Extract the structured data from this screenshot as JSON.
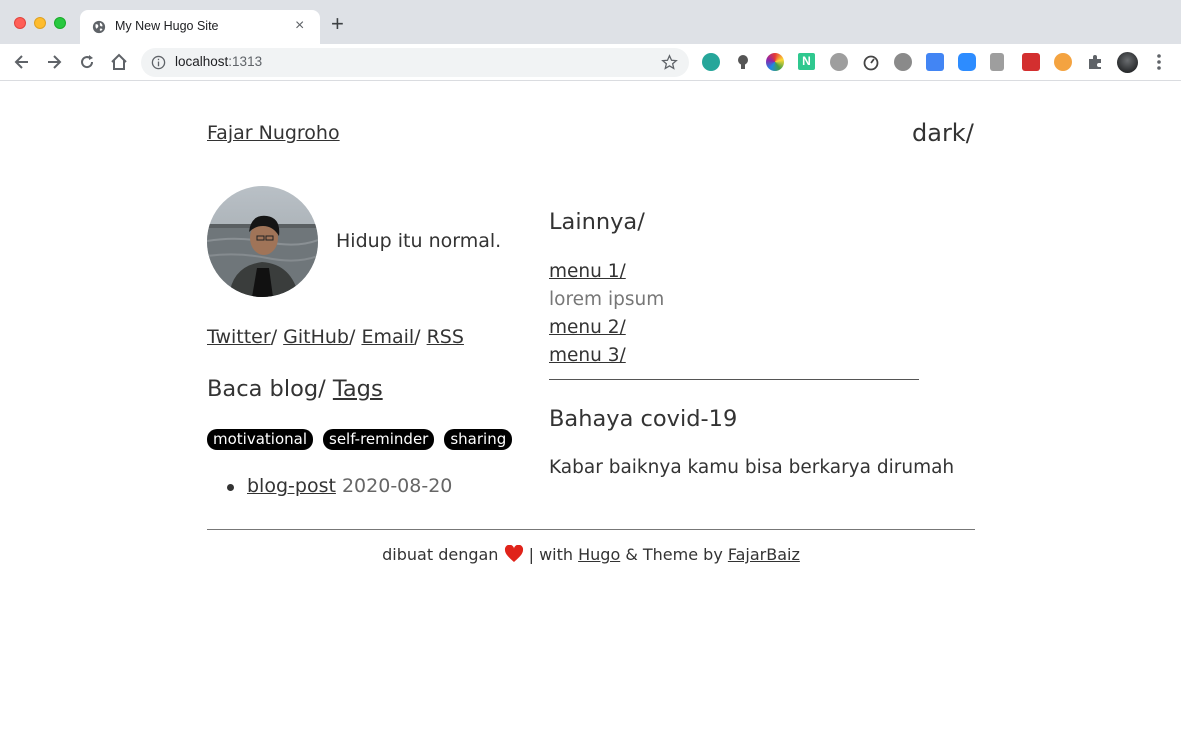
{
  "browser": {
    "tab_title": "My New Hugo Site",
    "tab_close": "×",
    "new_tab": "+",
    "url_host": "localhost",
    "url_port": ":1313"
  },
  "site": {
    "brand": "Fajar Nugroho",
    "mode_toggle": "dark/",
    "bio": "Hidup itu normal.",
    "social": [
      {
        "label": "Twitter",
        "sep": "/ "
      },
      {
        "label": "GitHub",
        "sep": "/ "
      },
      {
        "label": "Email",
        "sep": "/ "
      },
      {
        "label": "RSS",
        "sep": ""
      }
    ],
    "blog_heading": "Baca blog/ ",
    "tags_link": "Tags",
    "tags": [
      "motivational",
      "self-reminder",
      "sharing"
    ],
    "posts": [
      {
        "title": "blog-post",
        "date": "2020-08-20"
      }
    ]
  },
  "sidebar": {
    "heading": "Lainnya/",
    "menu1": "menu 1/",
    "menu1_desc": "lorem ipsum",
    "menu2": "menu 2/",
    "menu3": "menu 3/",
    "article_title": "Bahaya covid-19",
    "article_body": "Kabar baiknya kamu bisa berkarya dirumah"
  },
  "footer": {
    "prefix": "dibuat dengan ",
    "middle": " | with ",
    "hugo": "Hugo",
    "theme_by": " & Theme by ",
    "author": "FajarBaiz"
  },
  "colors": {
    "tag_bg": "#000000",
    "text": "#333333",
    "heart": "#e0231a"
  }
}
